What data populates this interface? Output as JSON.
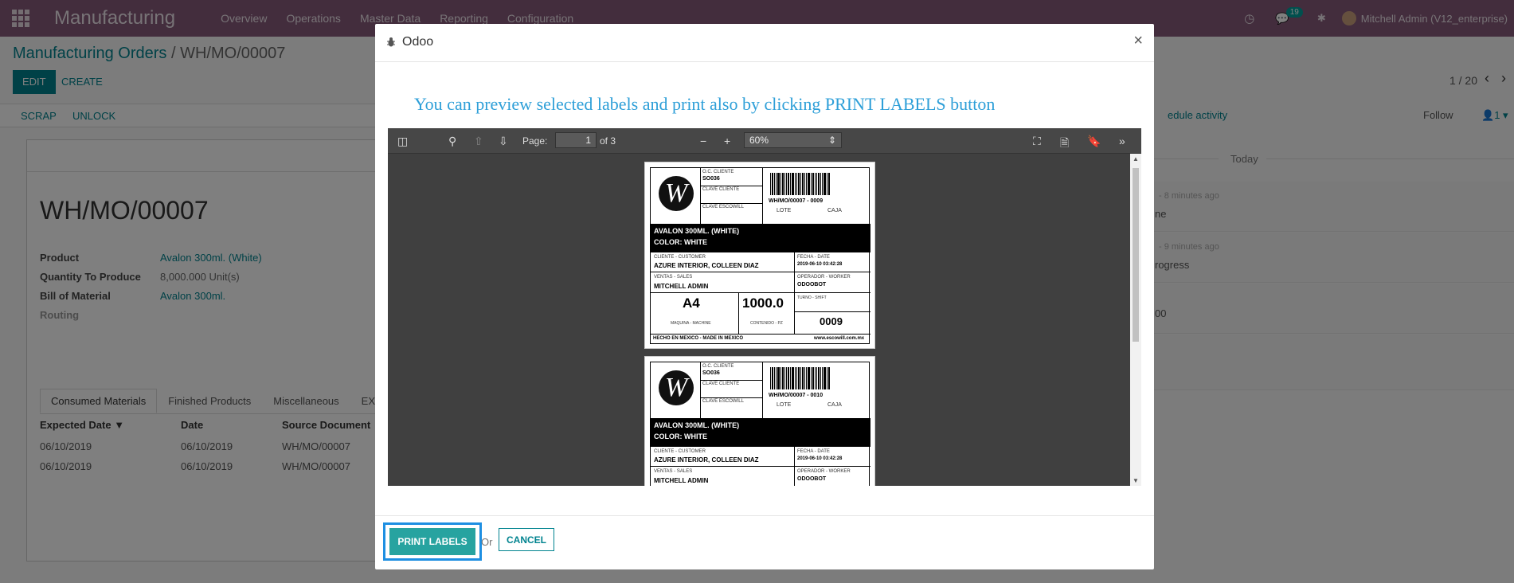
{
  "navbar": {
    "app_title": "Manufacturing",
    "menu": [
      "Overview",
      "Operations",
      "Master Data",
      "Reporting",
      "Configuration"
    ],
    "messages_count": "19",
    "user": "Mitchell Admin (V12_enterprise)"
  },
  "breadcrumb": {
    "parent": "Manufacturing Orders",
    "separator": "/",
    "current": "WH/MO/00007"
  },
  "buttons": {
    "edit": "EDIT",
    "create": "CREATE",
    "scrap": "SCRAP",
    "unlock": "UNLOCK"
  },
  "pager": {
    "value": "1 / 20"
  },
  "record": {
    "name": "WH/MO/00007",
    "fields": [
      {
        "label": "Product",
        "value": "Avalon 300ml. (White)"
      },
      {
        "label": "Quantity To Produce",
        "value": "8,000.000  Unit(s)"
      },
      {
        "label": "Bill of Material",
        "value": "Avalon 300ml."
      },
      {
        "label": "Routing",
        "value": ""
      }
    ],
    "tabs": [
      "Consumed Materials",
      "Finished Products",
      "Miscellaneous",
      "EXT"
    ],
    "columns": [
      "Expected Date",
      "Date",
      "Source Document"
    ],
    "rows": [
      [
        "06/10/2019",
        "06/10/2019",
        "WH/MO/00007"
      ],
      [
        "06/10/2019",
        "06/10/2019",
        "WH/MO/00007"
      ]
    ]
  },
  "chatter": {
    "schedule_activity": "edule activity",
    "follow": "Follow",
    "followers_count": "1",
    "today": "Today",
    "messages": [
      {
        "time": "- 8 minutes ago",
        "body": "ne"
      },
      {
        "time": "- 9 minutes ago",
        "body": "rogress"
      },
      {
        "time": "",
        "body": "00"
      }
    ]
  },
  "modal": {
    "title": "Odoo",
    "close": "×",
    "preview_text": "You can preview selected labels and print also by clicking PRINT LABELS button",
    "viewer": {
      "page_label": "Page:",
      "page_value": "1",
      "page_total": "of 3",
      "zoom": "60%"
    },
    "labels": [
      {
        "oc_title": "O.C. CLIENTE",
        "oc_value": "SO036",
        "clave_cliente": "CLAVE CLIENTE",
        "clave_escowill": "CLAVE ESCOWILL",
        "barcode_text": "WH/MO/00007 - 0009",
        "lote": "LOTE",
        "caja": "CAJA",
        "product_line1": "AVALON 300ML. (WHITE)",
        "product_line2": "COLOR: WHITE",
        "customer_title": "CLIENTE - CUSTOMER",
        "customer": "AZURE INTERIOR, COLLEEN DIAZ",
        "date_title": "FECHA - DATE",
        "date": "2019-06-10 03:42:28",
        "sales_title": "VENTAS - SALES",
        "sales": "MITCHELL ADMIN",
        "worker_title": "OPERADOR - WORKER",
        "worker": "ODOOBOT",
        "machine": "A4",
        "machine_title": "MAQUINA - MACHINE",
        "content": "1000.0",
        "content_title": "CONTENIDO - PZ",
        "shift_title": "TURNO - SHIFT",
        "shift": "0009",
        "made_in": "HECHO EN MEXICO - MADE IN MEXICO",
        "website": "www.escowill.com.mx"
      },
      {
        "oc_title": "O.C. CLIENTE",
        "oc_value": "SO036",
        "clave_cliente": "CLAVE CLIENTE",
        "clave_escowill": "CLAVE ESCOWILL",
        "barcode_text": "WH/MO/00007 - 0010",
        "lote": "LOTE",
        "caja": "CAJA",
        "product_line1": "AVALON 300ML. (WHITE)",
        "product_line2": "COLOR: WHITE",
        "customer_title": "CLIENTE - CUSTOMER",
        "customer": "AZURE INTERIOR, COLLEEN DIAZ",
        "date_title": "FECHA - DATE",
        "date": "2019-06-10 03:42:28",
        "sales_title": "VENTAS - SALES",
        "sales": "MITCHELL ADMIN",
        "worker_title": "OPERADOR - WORKER",
        "worker": "ODOOBOT"
      }
    ],
    "footer": {
      "print": "PRINT LABELS",
      "or": "Or",
      "cancel": "CANCEL"
    }
  },
  "colors": {
    "navbar": "#875a7b",
    "primary": "#00838f",
    "preview_text": "#2e9fd8",
    "highlight": "#1e8fe2"
  }
}
